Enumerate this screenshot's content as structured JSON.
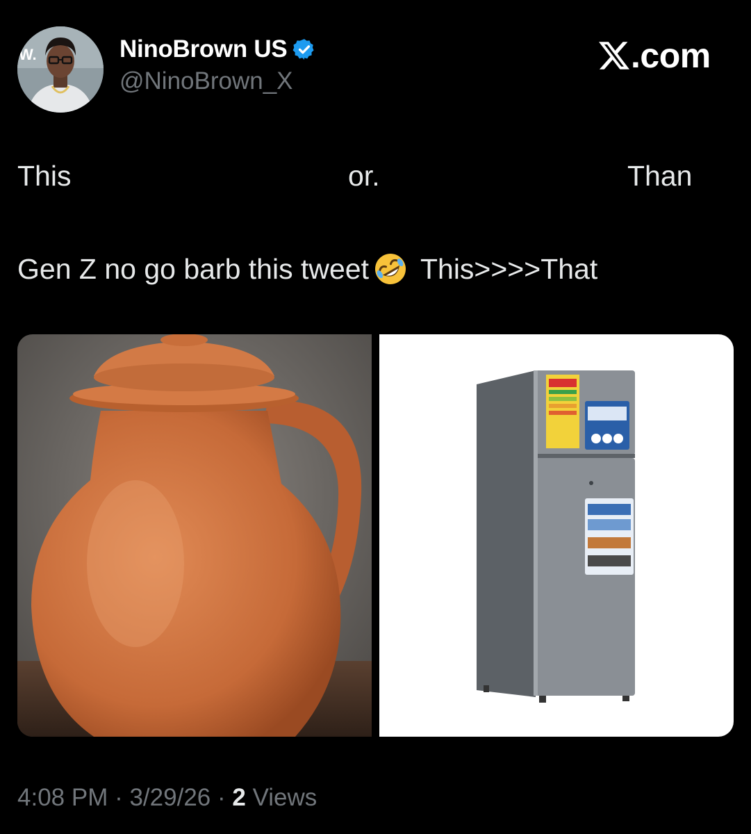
{
  "author": {
    "display_name": "NinoBrown US",
    "handle": "@NinoBrown_X",
    "verified": true,
    "avatar_badge_text": "W."
  },
  "brand": {
    "site_label": ".com",
    "logo_icon": "x-logo-icon"
  },
  "tweet": {
    "line1": {
      "word1": "This",
      "word2": "or.",
      "word3": "Than"
    },
    "line2": {
      "text_before_emoji": "Gen Z no go barb this tweet",
      "emoji": "rolling-on-the-floor-laughing-emoji",
      "text_after_emoji": "This>>>>That"
    }
  },
  "media": {
    "left_image": "clay-pot-jug",
    "right_image": "silver-refrigerator"
  },
  "meta": {
    "time": "4:08 PM",
    "separator": " · ",
    "date": "3/29/26",
    "views_count": "2",
    "views_label": "Views"
  },
  "colors": {
    "background": "#000000",
    "text_primary": "#e7e9ea",
    "text_secondary": "#71767b",
    "verified_blue": "#1d9bf0"
  }
}
